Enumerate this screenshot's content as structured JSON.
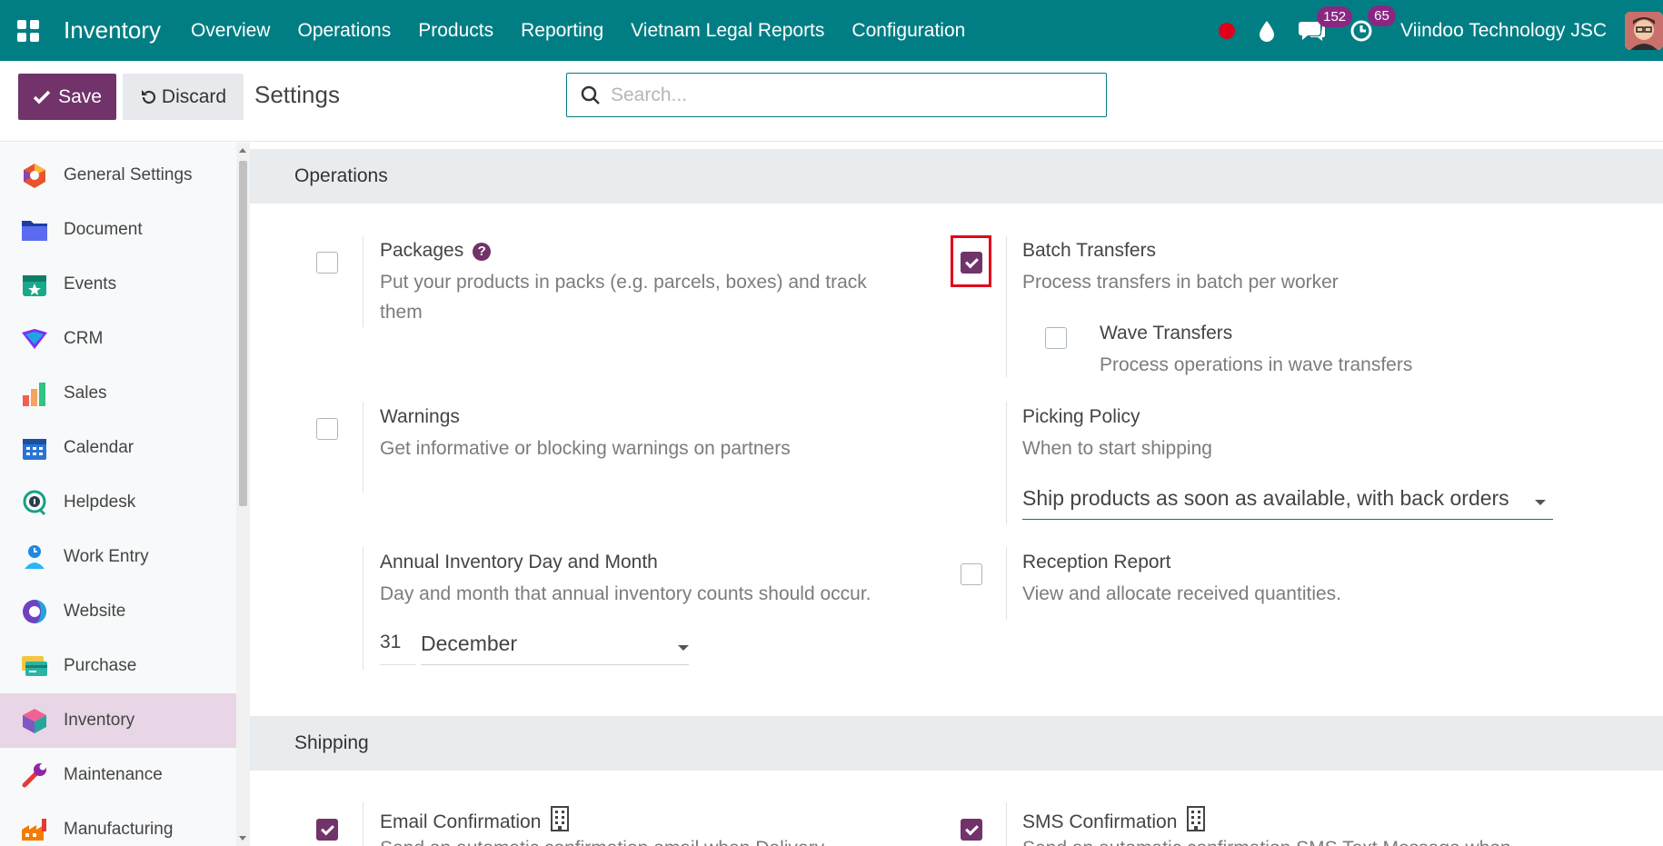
{
  "navbar": {
    "brand": "Inventory",
    "menu": [
      "Overview",
      "Operations",
      "Products",
      "Reporting",
      "Vietnam Legal Reports",
      "Configuration"
    ],
    "messages_count": "152",
    "activities_count": "65",
    "company": "Viindoo Technology JSC",
    "color": "#017e84"
  },
  "control": {
    "save_label": "Save",
    "discard_label": "Discard",
    "title": "Settings",
    "search_placeholder": "Search..."
  },
  "sidebar": {
    "items": [
      {
        "label": "General Settings",
        "icon": "general-settings-icon"
      },
      {
        "label": "Document",
        "icon": "document-icon"
      },
      {
        "label": "Events",
        "icon": "events-icon"
      },
      {
        "label": "CRM",
        "icon": "crm-icon"
      },
      {
        "label": "Sales",
        "icon": "sales-icon"
      },
      {
        "label": "Calendar",
        "icon": "calendar-icon"
      },
      {
        "label": "Helpdesk",
        "icon": "helpdesk-icon"
      },
      {
        "label": "Work Entry",
        "icon": "work-entry-icon"
      },
      {
        "label": "Website",
        "icon": "website-icon"
      },
      {
        "label": "Purchase",
        "icon": "purchase-icon"
      },
      {
        "label": "Inventory",
        "icon": "inventory-icon",
        "active": true
      },
      {
        "label": "Maintenance",
        "icon": "maintenance-icon"
      },
      {
        "label": "Manufacturing",
        "icon": "manufacturing-icon"
      }
    ]
  },
  "operations": {
    "heading": "Operations",
    "packages": {
      "title": "Packages",
      "help": "?",
      "desc": "Put your products in packs (e.g. parcels, boxes) and track them",
      "checked": false
    },
    "batch_transfers": {
      "title": "Batch Transfers",
      "desc": "Process transfers in batch per worker",
      "checked": true
    },
    "wave_transfers": {
      "title": "Wave Transfers",
      "desc": "Process operations in wave transfers",
      "checked": false
    },
    "warnings": {
      "title": "Warnings",
      "desc": "Get informative or blocking warnings on partners",
      "checked": false
    },
    "picking_policy": {
      "title": "Picking Policy",
      "desc": "When to start shipping",
      "value": "Ship products as soon as available, with back orders"
    },
    "annual_inventory": {
      "title": "Annual Inventory Day and Month",
      "desc": "Day and month that annual inventory counts should occur.",
      "day": "31",
      "month": "December"
    },
    "reception_report": {
      "title": "Reception Report",
      "desc": "View and allocate received quantities.",
      "checked": false
    }
  },
  "shipping": {
    "heading": "Shipping",
    "email_confirmation": {
      "title": "Email Confirmation",
      "desc": "Send an automatic confirmation email when Delivery",
      "checked": true
    },
    "sms_confirmation": {
      "title": "SMS Confirmation",
      "desc": "Send an automatic confirmation SMS Text Message when",
      "checked": true
    }
  }
}
